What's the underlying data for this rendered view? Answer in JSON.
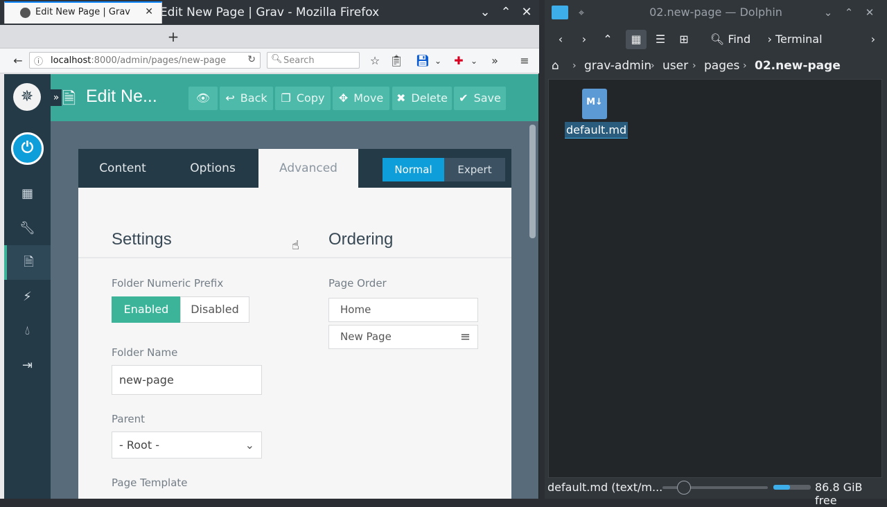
{
  "firefox": {
    "window_title": "Edit New Page | Grav - Mozilla Firefox",
    "tab_label": "Edit New Page | Grav",
    "url_host": "localhost",
    "url_path": ":8000/admin/pages/new-page",
    "search_placeholder": "Search"
  },
  "grav": {
    "header_title": "Edit Ne...",
    "buttons": {
      "back": "Back",
      "copy": "Copy",
      "move": "Move",
      "delete": "Delete",
      "save": "Save"
    },
    "tabs": [
      "Content",
      "Options",
      "Advanced"
    ],
    "active_tab": "Advanced",
    "mode": {
      "normal": "Normal",
      "expert": "Expert",
      "selected": "Normal"
    },
    "settings": {
      "heading": "Settings",
      "folder_numeric_prefix": {
        "label": "Folder Numeric Prefix",
        "on": "Enabled",
        "off": "Disabled",
        "selected": "Enabled"
      },
      "folder_name": {
        "label": "Folder Name",
        "value": "new-page"
      },
      "parent": {
        "label": "Parent",
        "value": "- Root -"
      },
      "page_template": {
        "label": "Page Template"
      }
    },
    "ordering": {
      "heading": "Ordering",
      "label": "Page Order",
      "items": [
        "Home",
        "New Page"
      ]
    },
    "colors": {
      "teal": "#3aa99a",
      "navy": "#253a47",
      "blue": "#0e9ed9"
    }
  },
  "dolphin": {
    "window_title": "02.new-page — Dolphin",
    "toolbar": {
      "find": "Find",
      "terminal": "Terminal"
    },
    "breadcrumb": [
      "grav-admin",
      "user",
      "pages",
      "02.new-page"
    ],
    "files": [
      {
        "name": "default.md",
        "icon": "markdown-file-icon"
      }
    ],
    "status": "default.md (text/m...",
    "free_space": "86.8 GiB free"
  }
}
